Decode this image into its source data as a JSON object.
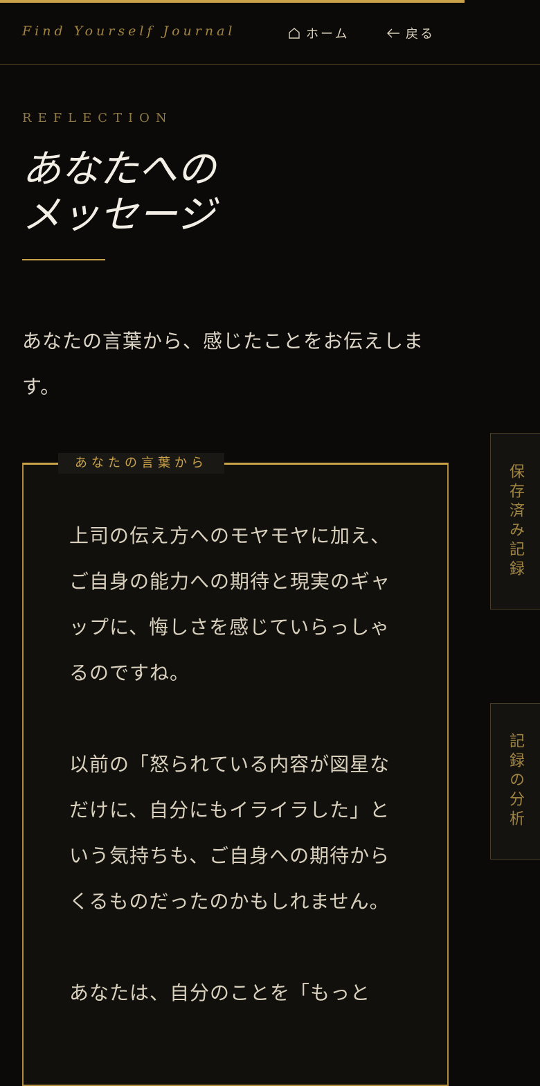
{
  "progress": {
    "percent": 86,
    "color": "#c9a24a"
  },
  "header": {
    "brand": "Find Yourself Journal",
    "home_label": "ホーム",
    "back_label": "戻る",
    "home_icon": "home-icon",
    "back_icon": "arrow-left-icon"
  },
  "hero": {
    "eyebrow": "REFLECTION",
    "title_line1": "あなたへの",
    "title_line2": "メッセージ"
  },
  "intro": "あなたの言葉から、感じたことをお伝えします。",
  "card": {
    "label": "あなたの言葉から",
    "paragraphs": [
      "上司の伝え方へのモヤモヤに加え、ご自身の能力への期待と現実のギャップに、悔しさを感じていらっしゃるのですね。",
      "以前の「怒られている内容が図星なだけに、自分にもイライラした」という気持ちも、ご自身への期待からくるものだったのかもしれません。",
      "あなたは、自分のことを「もっと"
    ]
  },
  "side_tabs": {
    "saved": "保存済み記録",
    "analysis": "記録の分析"
  },
  "colors": {
    "accent": "#c9a24a",
    "background": "#0b0a09"
  }
}
